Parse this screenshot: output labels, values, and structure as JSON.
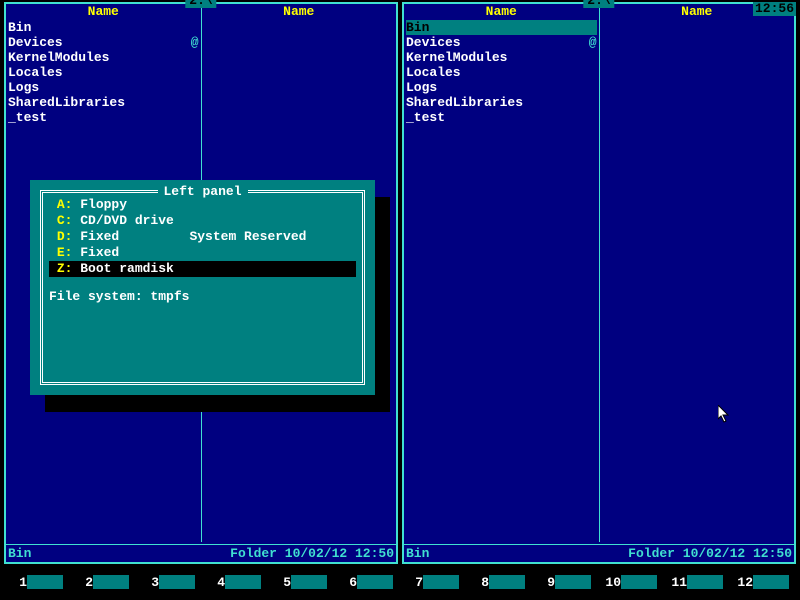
{
  "clock": "12:56",
  "panels": [
    {
      "title": "2:\\",
      "col_header": "Name",
      "status_name": "Bin",
      "status_info": "Folder 10/02/12 12:50",
      "items": [
        {
          "name": "Bin",
          "sel": false,
          "mark": ""
        },
        {
          "name": "Devices",
          "sel": false,
          "mark": "@"
        },
        {
          "name": "KernelModules",
          "sel": false,
          "mark": ""
        },
        {
          "name": "Locales",
          "sel": false,
          "mark": ""
        },
        {
          "name": "Logs",
          "sel": false,
          "mark": ""
        },
        {
          "name": "SharedLibraries",
          "sel": false,
          "mark": ""
        },
        {
          "name": "_test",
          "sel": false,
          "mark": ""
        }
      ]
    },
    {
      "title": "2:\\",
      "col_header": "Name",
      "status_name": "Bin",
      "status_info": "Folder 10/02/12 12:50",
      "items": [
        {
          "name": "Bin",
          "sel": true,
          "mark": ""
        },
        {
          "name": "Devices",
          "sel": false,
          "mark": "@"
        },
        {
          "name": "KernelModules",
          "sel": false,
          "mark": ""
        },
        {
          "name": "Locales",
          "sel": false,
          "mark": ""
        },
        {
          "name": "Logs",
          "sel": false,
          "mark": ""
        },
        {
          "name": "SharedLibraries",
          "sel": false,
          "mark": ""
        },
        {
          "name": "_test",
          "sel": false,
          "mark": ""
        }
      ]
    }
  ],
  "dialog": {
    "title": "Left panel",
    "fs_label": "File system: tmpfs",
    "drives": [
      {
        "letter": "A:",
        "desc": "Floppy",
        "extra": "",
        "sel": false
      },
      {
        "letter": "C:",
        "desc": "CD/DVD drive",
        "extra": "",
        "sel": false
      },
      {
        "letter": "D:",
        "desc": "Fixed",
        "extra": "System Reserved",
        "sel": false
      },
      {
        "letter": "E:",
        "desc": "Fixed",
        "extra": "",
        "sel": false
      },
      {
        "letter": "Z:",
        "desc": "Boot ramdisk",
        "extra": "",
        "sel": true
      }
    ]
  },
  "fkeys": [
    "1",
    "2",
    "3",
    "4",
    "5",
    "6",
    "7",
    "8",
    "9",
    "10",
    "11",
    "12"
  ]
}
